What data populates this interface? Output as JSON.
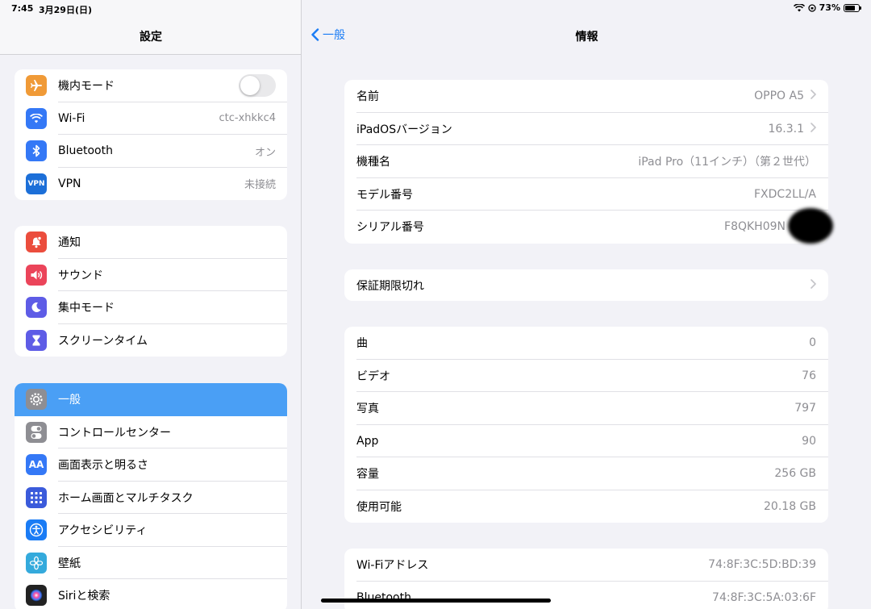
{
  "status": {
    "time": "7:45",
    "date": "3月29日(日)",
    "battery": "73%",
    "battery_level": 0.73
  },
  "sidebar": {
    "title": "設定",
    "groups": [
      [
        {
          "label": "機内モード",
          "icon": "airplane-icon",
          "color": "#f09a37",
          "toggle": false
        },
        {
          "label": "Wi-Fi",
          "value": "ctc-xhkkc4",
          "icon": "wifi-icon",
          "color": "#3478f6"
        },
        {
          "label": "Bluetooth",
          "value": "オン",
          "icon": "bluetooth-icon",
          "color": "#3478f6"
        },
        {
          "label": "VPN",
          "value": "未接続",
          "icon": "vpn-icon",
          "color": "#1c6fd8",
          "icon_text": "VPN"
        }
      ],
      [
        {
          "label": "通知",
          "icon": "bell-icon",
          "color": "#eb4d3d"
        },
        {
          "label": "サウンド",
          "icon": "speaker-icon",
          "color": "#eb445a"
        },
        {
          "label": "集中モード",
          "icon": "moon-icon",
          "color": "#5e5ce6"
        },
        {
          "label": "スクリーンタイム",
          "icon": "hourglass-icon",
          "color": "#5e5ce6"
        }
      ],
      [
        {
          "label": "一般",
          "icon": "gear-icon",
          "color": "#8e8e93",
          "selected": true
        },
        {
          "label": "コントロールセンター",
          "icon": "switches-icon",
          "color": "#8e8e93"
        },
        {
          "label": "画面表示と明るさ",
          "icon": "text-size-icon",
          "color": "#3478f6",
          "icon_text": "AA"
        },
        {
          "label": "ホーム画面とマルチタスク",
          "icon": "grid-icon",
          "color": "#3b5bdb"
        },
        {
          "label": "アクセシビリティ",
          "icon": "accessibility-icon",
          "color": "#1a7cf5"
        },
        {
          "label": "壁紙",
          "icon": "flower-icon",
          "color": "#34aadc"
        },
        {
          "label": "Siriと検索",
          "icon": "siri-icon",
          "color": "#222222"
        }
      ]
    ]
  },
  "detail": {
    "back_label": "一般",
    "title": "情報",
    "groups": [
      [
        {
          "label": "名前",
          "value": "OPPO A5",
          "chevron": true
        },
        {
          "label": "iPadOSバージョン",
          "value": "16.3.1",
          "chevron": true
        },
        {
          "label": "機種名",
          "value": "iPad Pro（11インチ）（第２世代）"
        },
        {
          "label": "モデル番号",
          "value": "FXDC2LL/A"
        },
        {
          "label": "シリアル番号",
          "value": "F8QKH09N"
        }
      ],
      [
        {
          "label": "保証期限切れ",
          "value": "",
          "chevron": true
        }
      ],
      [
        {
          "label": "曲",
          "value": "0"
        },
        {
          "label": "ビデオ",
          "value": "76"
        },
        {
          "label": "写真",
          "value": "797"
        },
        {
          "label": "App",
          "value": "90"
        },
        {
          "label": "容量",
          "value": "256 GB"
        },
        {
          "label": "使用可能",
          "value": "20.18 GB"
        }
      ],
      [
        {
          "label": "Wi-Fiアドレス",
          "value": "74:8F:3C:5D:BD:39"
        },
        {
          "label": "Bluetooth",
          "value": "74:8F:3C:5A:03:6F"
        }
      ]
    ]
  }
}
